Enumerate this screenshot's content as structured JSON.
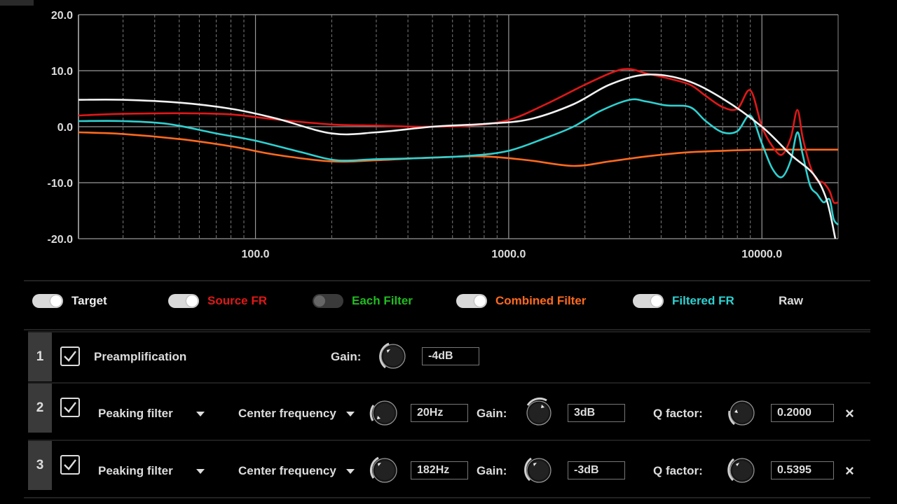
{
  "chart_data": {
    "type": "line",
    "x_scale": "log",
    "xlim": [
      20,
      20000
    ],
    "ylim": [
      -20,
      20
    ],
    "x_ticks": [
      {
        "value": 100,
        "label": "100.0"
      },
      {
        "value": 1000,
        "label": "1000.0"
      },
      {
        "value": 10000,
        "label": "10000.0"
      }
    ],
    "y_ticks": [
      {
        "value": 20,
        "label": "20.0"
      },
      {
        "value": 10,
        "label": "10.0"
      },
      {
        "value": 0,
        "label": "0.0"
      },
      {
        "value": -10,
        "label": "-10.0"
      },
      {
        "value": -20,
        "label": "-20.0"
      }
    ],
    "grid": true,
    "series": [
      {
        "name": "Combined Filter",
        "color": "#ff6a1f",
        "x": [
          20,
          30,
          50,
          80,
          120,
          200,
          300,
          500,
          800,
          1200,
          1800,
          2500,
          3500,
          5000,
          7000,
          10000,
          14000,
          20000
        ],
        "y": [
          -1,
          -1.3,
          -2.2,
          -3.5,
          -5,
          -6.2,
          -6,
          -5.5,
          -5.3,
          -6,
          -7,
          -6.2,
          -5.3,
          -4.6,
          -4.3,
          -4.1,
          -4.1,
          -4.1
        ]
      },
      {
        "name": "Filtered FR",
        "color": "#2fd1d1",
        "x": [
          20,
          30,
          45,
          70,
          100,
          150,
          210,
          300,
          450,
          700,
          1000,
          1400,
          1800,
          2300,
          3000,
          3500,
          4200,
          5200,
          6000,
          7000,
          8000,
          9000,
          10000,
          11000,
          12000,
          13000,
          13800,
          14500,
          15500,
          16500,
          17500,
          18500,
          19200,
          20000
        ],
        "y": [
          1,
          1,
          0.5,
          -1.2,
          -2.5,
          -4.5,
          -6,
          -5.8,
          -5.6,
          -5.2,
          -4.3,
          -2,
          0,
          2.8,
          4.8,
          4.5,
          3.8,
          3.5,
          1,
          -1,
          -0.8,
          2,
          -3,
          -7.5,
          -9,
          -6,
          -1,
          -5,
          -10.5,
          -12,
          -13.5,
          -13,
          -16.5,
          -17.5
        ]
      },
      {
        "name": "Source FR",
        "color": "#e01818",
        "x": [
          20,
          30,
          50,
          80,
          120,
          200,
          300,
          450,
          700,
          1000,
          1400,
          2000,
          2600,
          3000,
          3500,
          4200,
          5200,
          6000,
          7000,
          8000,
          9000,
          10000,
          11000,
          12000,
          13000,
          13800,
          14500,
          15500,
          16500,
          17500,
          18500,
          19200,
          20000
        ],
        "y": [
          2,
          2.3,
          2.4,
          2.2,
          1.3,
          0.4,
          0.2,
          0,
          0.2,
          1.2,
          4,
          7.5,
          9.8,
          10.3,
          9.5,
          8.7,
          7.5,
          5.5,
          3.5,
          3.2,
          6.5,
          0,
          -3.5,
          -5,
          -2,
          3,
          -2,
          -7,
          -9.5,
          -10,
          -11.5,
          -13.5,
          -13.5
        ]
      },
      {
        "name": "Target",
        "color": "#f2f2f2",
        "x": [
          20,
          30,
          50,
          80,
          120,
          200,
          300,
          500,
          800,
          1200,
          1800,
          2500,
          3500,
          5000,
          7000,
          10000,
          13000,
          16000,
          18000,
          19500
        ],
        "y": [
          4.8,
          4.8,
          4.3,
          3.2,
          1.5,
          -1.2,
          -1,
          0,
          0.5,
          1.3,
          4,
          7.5,
          9.3,
          8.3,
          5,
          0,
          -5,
          -8.5,
          -13,
          -20
        ]
      }
    ]
  },
  "legend": [
    {
      "label": "Target",
      "color": "#eeeeee",
      "on": true
    },
    {
      "label": "Source FR",
      "color": "#e01818",
      "on": true
    },
    {
      "label": "Each Filter",
      "color": "#22bb22",
      "on": false
    },
    {
      "label": "Combined Filter",
      "color": "#ff6a1f",
      "on": true
    },
    {
      "label": "Filtered FR",
      "color": "#2fd1d1",
      "on": true
    },
    {
      "label": "Raw",
      "color": "#dddddd"
    }
  ],
  "filters": [
    {
      "num": "1",
      "type": "Preamplification",
      "gain_label": "Gain:",
      "gain": "-4dB"
    },
    {
      "num": "2",
      "type": "Peaking filter",
      "param_label": "Center frequency",
      "param_value": "20Hz",
      "gain_label": "Gain:",
      "gain": "3dB",
      "q_label": "Q factor:",
      "q": "0.2000",
      "remove": "×"
    },
    {
      "num": "3",
      "type": "Peaking filter",
      "param_label": "Center frequency",
      "param_value": "182Hz",
      "gain_label": "Gain:",
      "gain": "-3dB",
      "q_label": "Q factor:",
      "q": "0.5395",
      "remove": "×"
    }
  ]
}
